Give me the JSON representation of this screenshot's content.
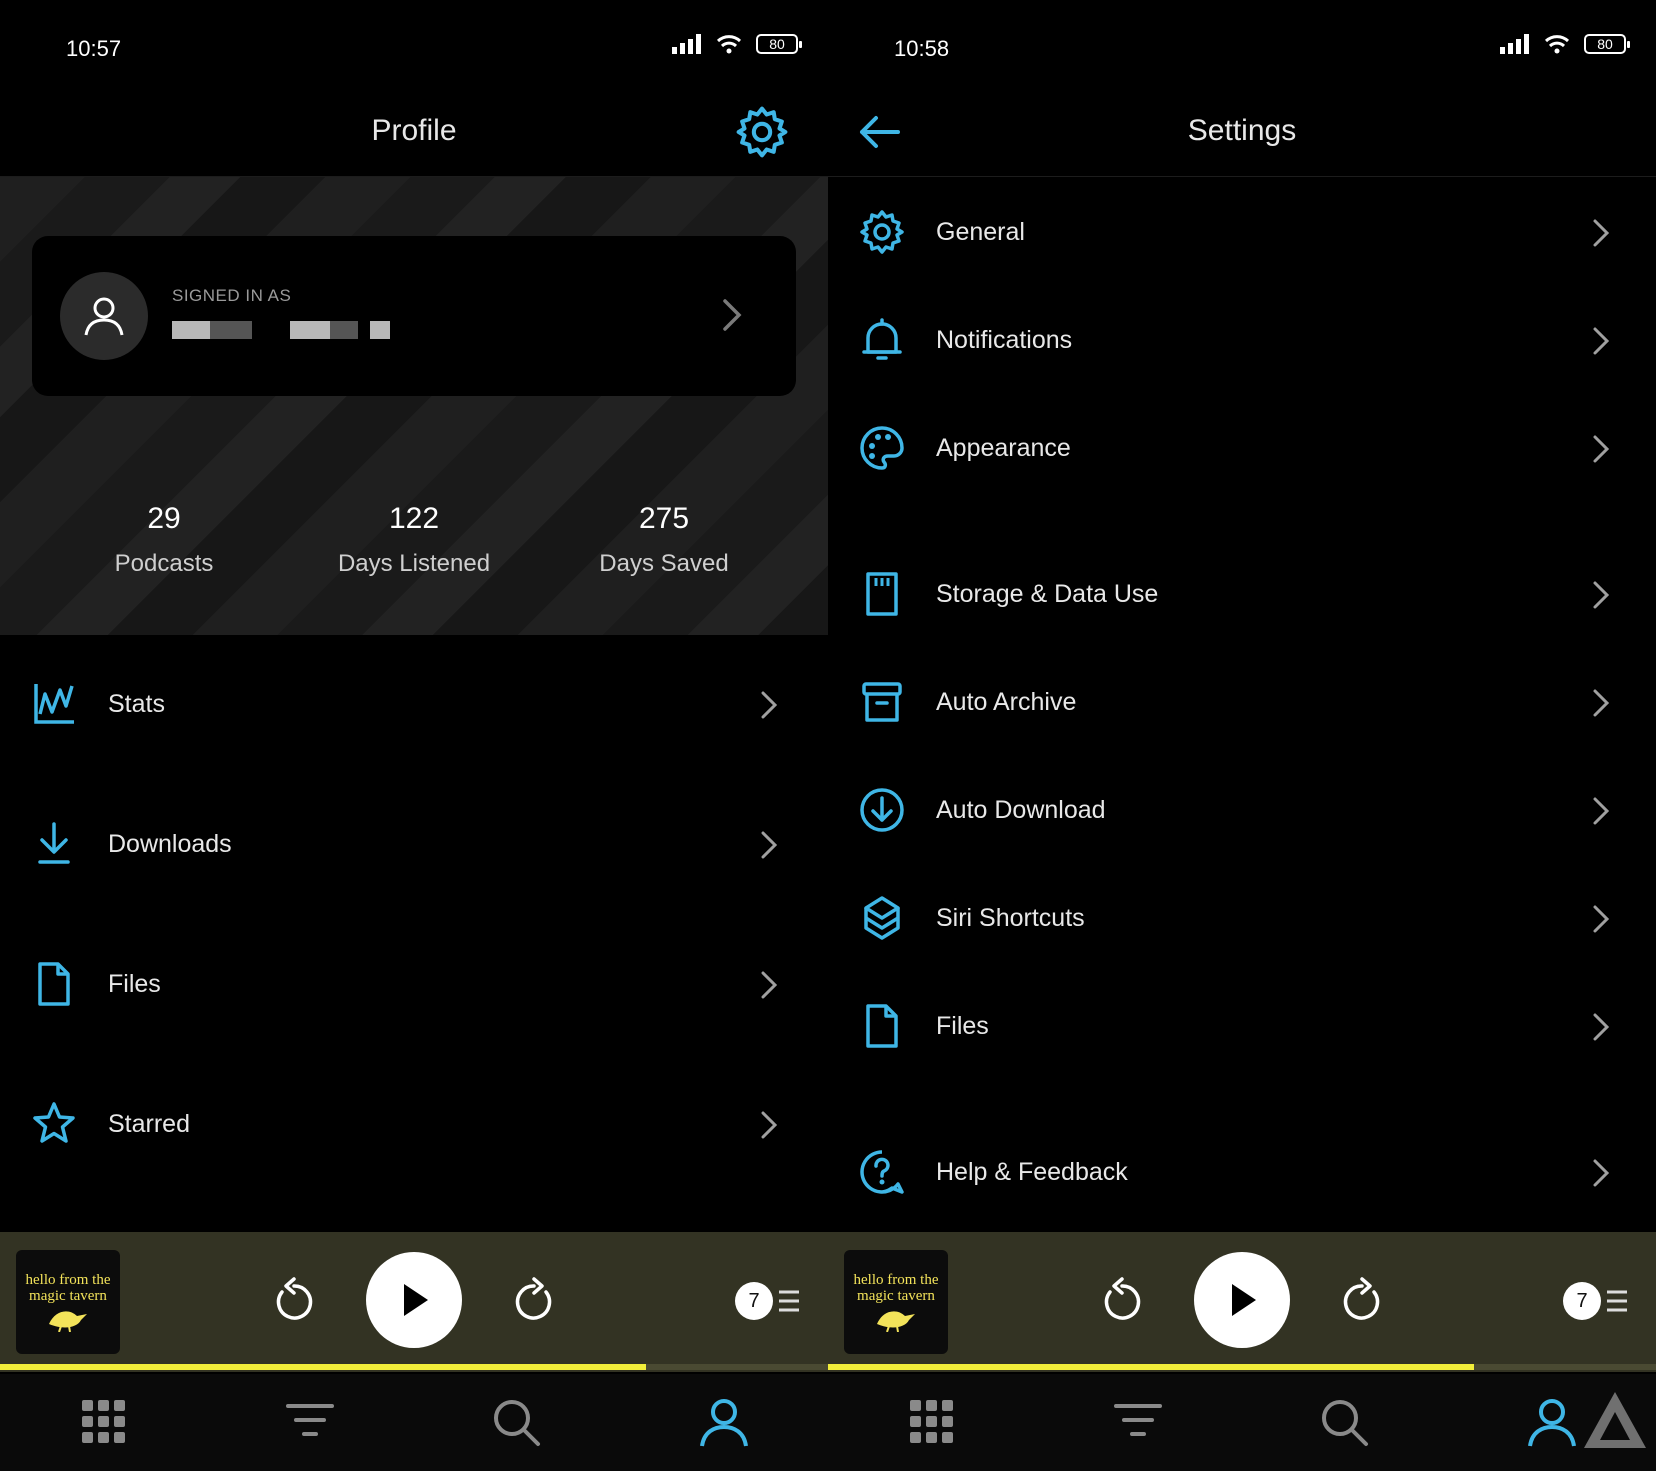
{
  "left": {
    "status": {
      "time": "10:57",
      "battery": "80"
    },
    "header": {
      "title": "Profile"
    },
    "account": {
      "signed_in_label": "SIGNED IN AS"
    },
    "stats": [
      {
        "value": "29",
        "label": "Podcasts"
      },
      {
        "value": "122",
        "label": "Days Listened"
      },
      {
        "value": "275",
        "label": "Days Saved"
      }
    ],
    "menu": [
      {
        "label": "Stats",
        "icon": "stats-chart-icon"
      },
      {
        "label": "Downloads",
        "icon": "download-icon"
      },
      {
        "label": "Files",
        "icon": "file-icon"
      },
      {
        "label": "Starred",
        "icon": "star-icon"
      }
    ],
    "player": {
      "artwork_text_1": "hello from the",
      "artwork_text_2": "magic tavern",
      "queue_count": "7",
      "progress": 0.78
    }
  },
  "right": {
    "status": {
      "time": "10:58",
      "battery": "80"
    },
    "header": {
      "title": "Settings"
    },
    "menu": [
      {
        "label": "General",
        "icon": "gear-icon"
      },
      {
        "label": "Notifications",
        "icon": "bell-icon"
      },
      {
        "label": "Appearance",
        "icon": "palette-icon"
      },
      {
        "label": "Storage & Data Use",
        "icon": "sd-card-icon"
      },
      {
        "label": "Auto Archive",
        "icon": "archive-icon"
      },
      {
        "label": "Auto Download",
        "icon": "download-circle-icon"
      },
      {
        "label": "Siri Shortcuts",
        "icon": "shortcuts-icon"
      },
      {
        "label": "Files",
        "icon": "file-icon"
      },
      {
        "label": "Help & Feedback",
        "icon": "help-icon"
      }
    ],
    "player": {
      "artwork_text_1": "hello from the",
      "artwork_text_2": "magic tavern",
      "queue_count": "7",
      "progress": 0.78
    }
  },
  "colors": {
    "accent": "#3fb6e6",
    "progress": "#f2ee3a",
    "player_bg": "#333323"
  },
  "tabs": [
    "grid-icon",
    "filter-icon",
    "search-icon",
    "profile-icon"
  ]
}
